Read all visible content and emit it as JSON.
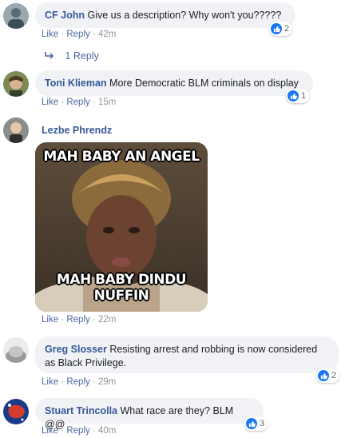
{
  "comments": [
    {
      "author": "CF John",
      "text": "Give us a description? Why won't you?????",
      "like": "Like",
      "reply": "Reply",
      "time": "42m",
      "reactions": "2"
    },
    {
      "author": "Toni Klieman",
      "text": "More Democratic BLM criminals on display",
      "like": "Like",
      "reply": "Reply",
      "time": "15m",
      "reactions": "1"
    },
    {
      "author": "Lezbe Phrendz",
      "meme_top": "MAH BABY AN ANGEL",
      "meme_bottom": "MAH BABY DINDU NUFFIN",
      "like": "Like",
      "reply": "Reply",
      "time": "22m"
    },
    {
      "author": "Greg Slosser",
      "text": "Resisting arrest and robbing is now considered as Black Privilege.",
      "like": "Like",
      "reply": "Reply",
      "time": "29m",
      "reactions": "2"
    },
    {
      "author": "Stuart Trincolla",
      "text": "What race are they? BLM @@",
      "like": "Like",
      "reply": "Reply",
      "time": "40m",
      "reactions": "3"
    }
  ],
  "replies_link": "1 Reply",
  "separator": "·",
  "colors": {
    "author": "#365899",
    "bubble": "#f0f2f5",
    "like_blue": "#1877f2",
    "meta": "#90949c"
  },
  "icons": {
    "reply_arrow": "reply-arrow-icon",
    "like": "like-thumb-icon"
  }
}
